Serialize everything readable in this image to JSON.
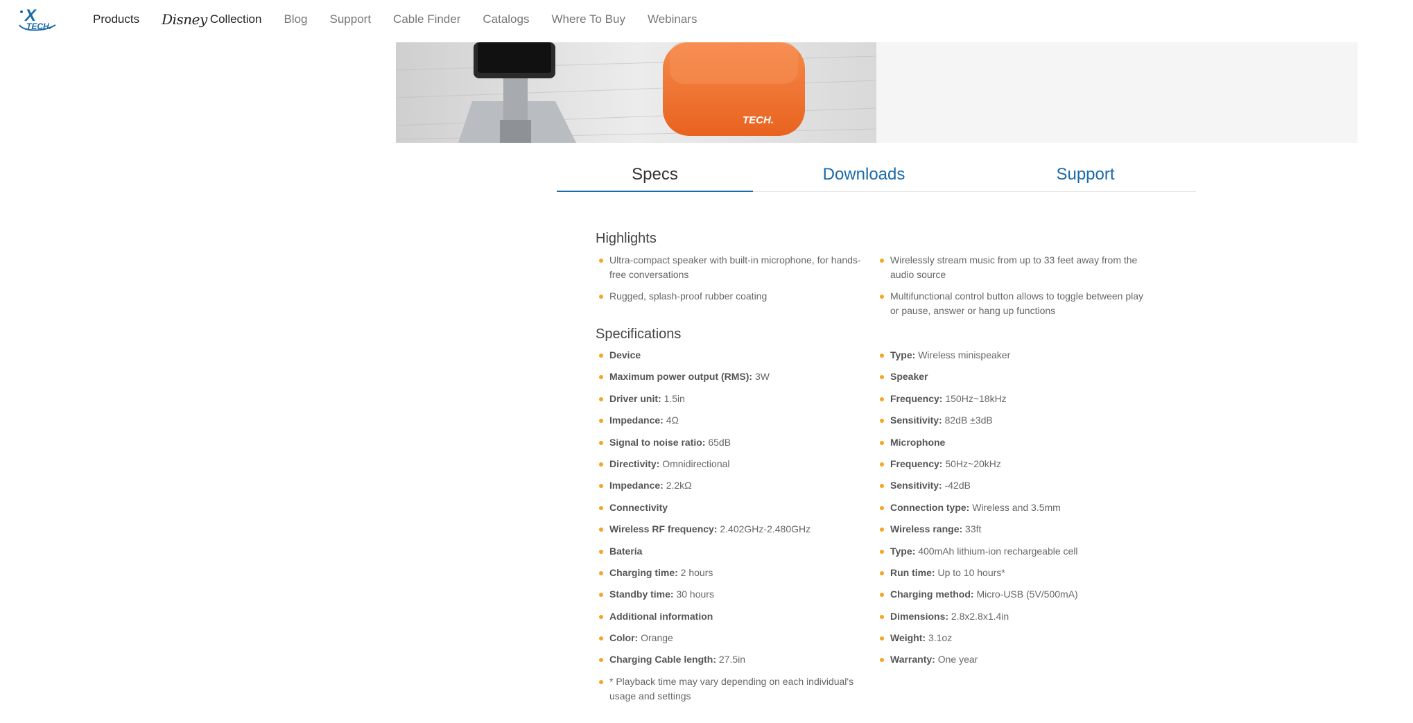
{
  "brand": {
    "logo_x": "X",
    "logo_tech": "TECH."
  },
  "nav": {
    "products": "Products",
    "disney_word": "Disney",
    "collection": "Collection",
    "blog": "Blog",
    "support": "Support",
    "cable_finder": "Cable Finder",
    "catalogs": "Catalogs",
    "where_to_buy": "Where To Buy",
    "webinars": "Webinars"
  },
  "hero": {
    "product_logo": "TECH."
  },
  "tabs": {
    "specs": "Specs",
    "downloads": "Downloads",
    "support": "Support"
  },
  "highlights": {
    "title": "Highlights",
    "left": [
      "Ultra-compact speaker with built-in microphone, for hands-free conversations",
      "Rugged, splash-proof rubber coating"
    ],
    "right": [
      "Wirelessly stream music from up to 33 feet away from the audio source",
      "Multifunctional control button allows to toggle between play or pause, answer or hang up functions"
    ]
  },
  "specifications": {
    "title": "Specifications",
    "left": [
      {
        "label": "Device",
        "value": ""
      },
      {
        "label": "Maximum power output (RMS):",
        "value": "3W"
      },
      {
        "label": "Driver unit:",
        "value": "1.5in"
      },
      {
        "label": "Impedance:",
        "value": "4Ω"
      },
      {
        "label": "Signal to noise ratio:",
        "value": "65dB"
      },
      {
        "label": "Directivity:",
        "value": "Omnidirectional"
      },
      {
        "label": "Impedance:",
        "value": "2.2kΩ"
      },
      {
        "label": "Connectivity",
        "value": ""
      },
      {
        "label": "Wireless RF frequency:",
        "value": "2.402GHz-2.480GHz"
      },
      {
        "label": "Batería",
        "value": ""
      },
      {
        "label": "Charging time:",
        "value": "2 hours"
      },
      {
        "label": "Standby time:",
        "value": "30 hours"
      },
      {
        "label": "Additional information",
        "value": ""
      },
      {
        "label": "Color:",
        "value": "Orange"
      },
      {
        "label": "Charging Cable length:",
        "value": "27.5in"
      }
    ],
    "right": [
      {
        "label": "Type:",
        "value": "Wireless minispeaker"
      },
      {
        "label": "Speaker",
        "value": ""
      },
      {
        "label": "Frequency:",
        "value": "150Hz~18kHz"
      },
      {
        "label": "Sensitivity:",
        "value": "82dB ±3dB"
      },
      {
        "label": "Microphone",
        "value": ""
      },
      {
        "label": "Frequency:",
        "value": "50Hz~20kHz"
      },
      {
        "label": "Sensitivity:",
        "value": "-42dB"
      },
      {
        "label": "Connection type:",
        "value": "Wireless and 3.5mm"
      },
      {
        "label": "Wireless range:",
        "value": "33ft"
      },
      {
        "label": "Type:",
        "value": "400mAh lithium-ion rechargeable cell"
      },
      {
        "label": "Run time:",
        "value": "Up to 10 hours*"
      },
      {
        "label": "Charging method:",
        "value": "Micro-USB (5V/500mA)"
      },
      {
        "label": "Dimensions:",
        "value": "2.8x2.8x1.4in"
      },
      {
        "label": "Weight:",
        "value": "3.1oz"
      },
      {
        "label": "Warranty:",
        "value": "One year"
      }
    ],
    "footnote": "* Playback time may vary depending on each individual's usage and settings"
  },
  "colors": {
    "accent": "#1a6aa8",
    "bullet": "#f5a623",
    "product": "#f36f2c"
  }
}
